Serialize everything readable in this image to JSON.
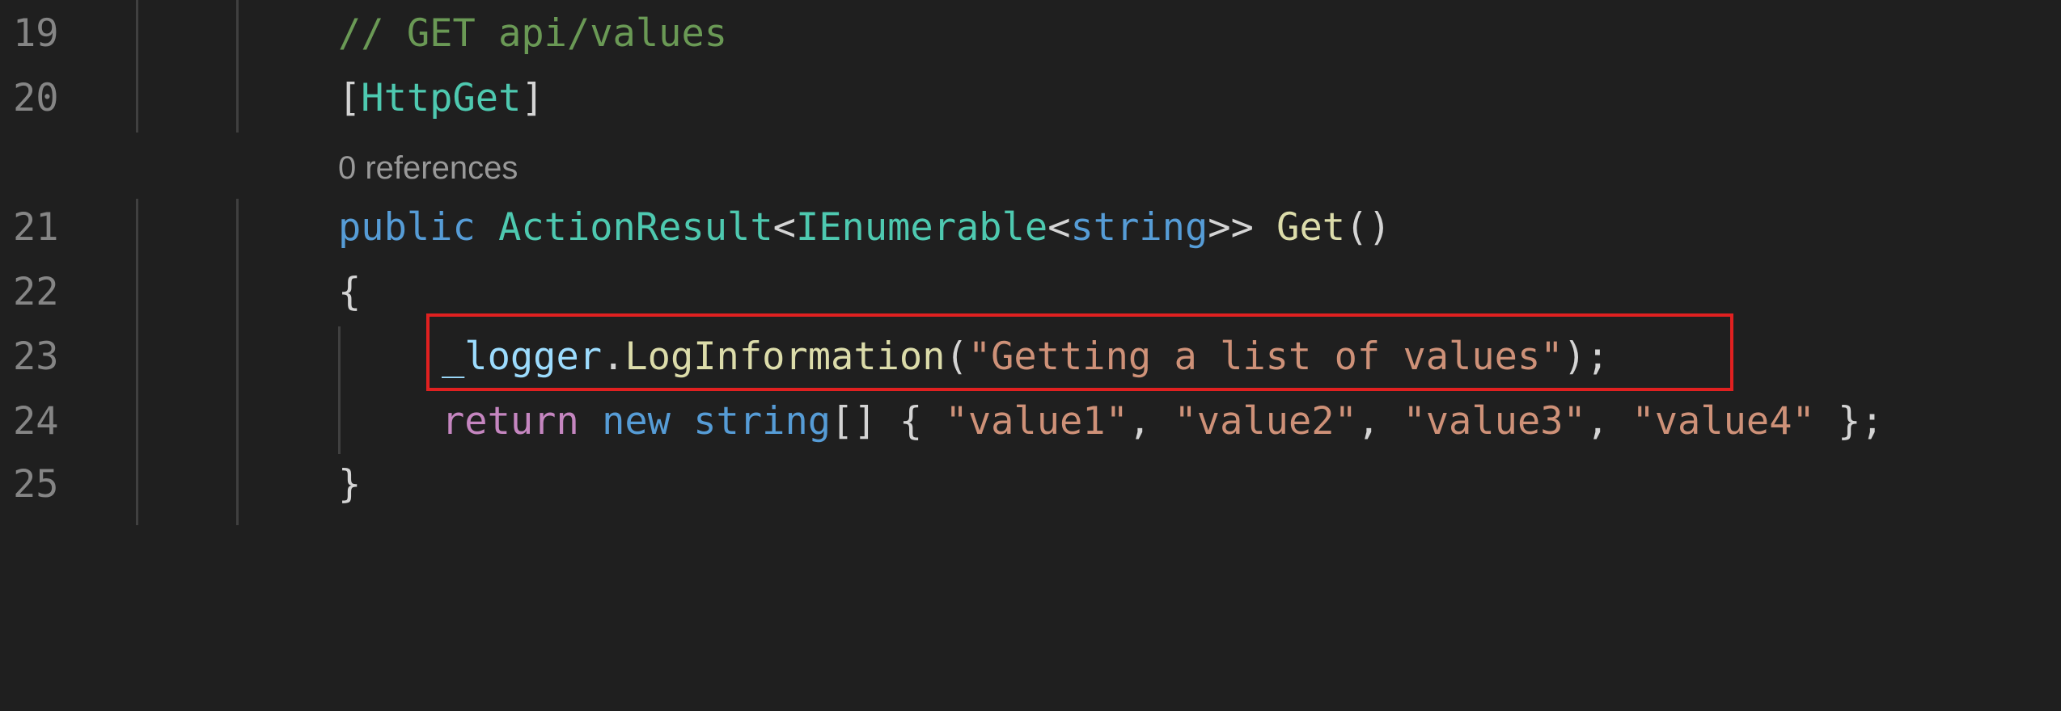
{
  "editor": {
    "codelens": "0 references",
    "lines": [
      {
        "number": "19",
        "tokens": [
          "// GET api/values"
        ]
      },
      {
        "number": "20",
        "tokens": [
          "[",
          "HttpGet",
          "]"
        ]
      },
      {
        "number": "21",
        "tokens": [
          "public",
          " ",
          "ActionResult",
          "<",
          "IEnumerable",
          "<",
          "string",
          ">>",
          " ",
          "Get",
          "()"
        ]
      },
      {
        "number": "22",
        "tokens": [
          "{"
        ]
      },
      {
        "number": "23",
        "tokens": [
          "_logger",
          ".",
          "LogInformation",
          "(",
          "\"Getting a list of values\"",
          ");"
        ]
      },
      {
        "number": "24",
        "tokens": [
          "return",
          " ",
          "new",
          " ",
          "string",
          "[] { ",
          "\"value1\"",
          ", ",
          "\"value2\"",
          ", ",
          "\"value3\"",
          ", ",
          "\"value4\"",
          " };"
        ]
      },
      {
        "number": "25",
        "tokens": [
          "}"
        ]
      }
    ]
  },
  "colors": {
    "background": "#1f1f1f",
    "line_number": "#858585",
    "comment": "#6a9955",
    "type": "#4ec9b0",
    "keyword": "#569cd6",
    "control_keyword": "#c586c0",
    "method": "#dcdcaa",
    "variable": "#9cdcfe",
    "string": "#ce9178",
    "highlight_box": "#e02020"
  }
}
